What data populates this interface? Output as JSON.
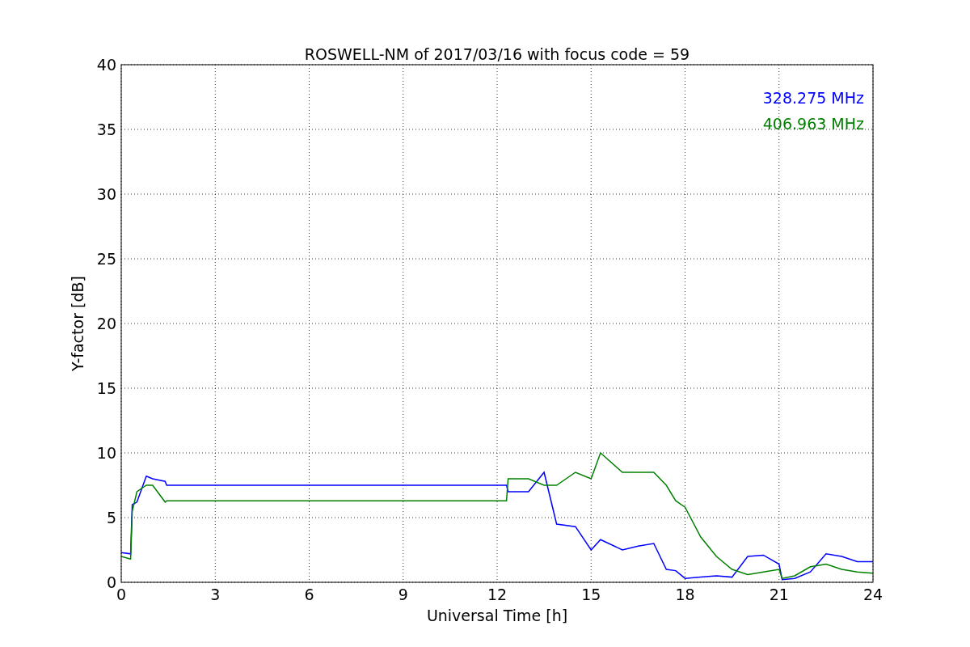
{
  "chart_data": {
    "type": "line",
    "title": "ROSWELL-NM of 2017/03/16 with focus code = 59",
    "xlabel": "Universal Time [h]",
    "ylabel": "Y-factor [dB]",
    "x": [
      0,
      0.3,
      0.35,
      0.5,
      0.8,
      1.0,
      1.4,
      1.45,
      12.3,
      12.35,
      13,
      13.5,
      13.9,
      14.5,
      15,
      15.3,
      16,
      16.5,
      17,
      17.4,
      17.7,
      18,
      18.5,
      19,
      19.5,
      20,
      20.5,
      21,
      21.1,
      21.5,
      22,
      22.5,
      23,
      23.5,
      24
    ],
    "series": [
      {
        "name": "328.275 MHz",
        "color": "#0000ff",
        "values": [
          2.3,
          2.2,
          6,
          6.2,
          8.2,
          8,
          7.8,
          7.5,
          7.5,
          7,
          7,
          8.5,
          4.5,
          4.3,
          2.5,
          3.3,
          2.5,
          2.8,
          3.0,
          1.0,
          0.9,
          0.3,
          0.4,
          0.5,
          0.4,
          2.0,
          2.1,
          1.4,
          0.2,
          0.3,
          0.8,
          2.2,
          2.0,
          1.6,
          1.6
        ]
      },
      {
        "name": "406.963 MHz",
        "color": "#008000",
        "values": [
          2.0,
          1.8,
          5.5,
          7,
          7.5,
          7.5,
          6.2,
          6.3,
          6.3,
          8,
          8,
          7.5,
          7.5,
          8.5,
          8,
          10,
          8.5,
          8.5,
          8.5,
          7.5,
          6.3,
          5.8,
          3.5,
          2.0,
          1.0,
          0.6,
          0.8,
          1.0,
          0.3,
          0.5,
          1.2,
          1.4,
          1.0,
          0.8,
          0.7
        ]
      }
    ],
    "xlim": [
      0,
      24
    ],
    "ylim": [
      0,
      40
    ],
    "xticks": [
      0,
      3,
      6,
      9,
      12,
      15,
      18,
      21,
      24
    ],
    "yticks": [
      0,
      5,
      10,
      15,
      20,
      25,
      30,
      35,
      40
    ],
    "grid": true
  }
}
